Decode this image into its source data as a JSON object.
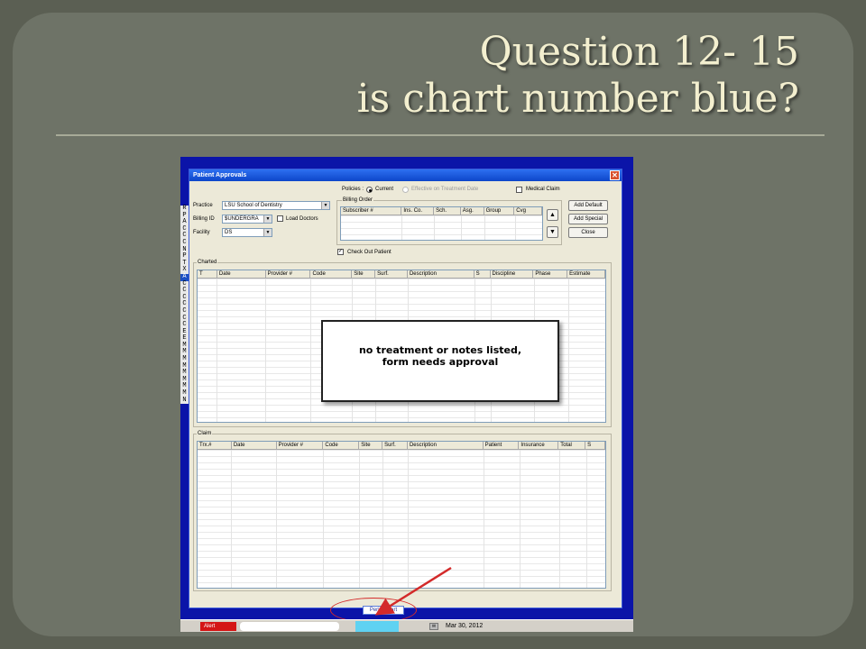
{
  "slide": {
    "title_line1": "Question 12- 15",
    "title_line2": "is chart number blue?"
  },
  "app": {
    "side_letters": [
      "R",
      "P",
      "A",
      "C",
      "C",
      "C",
      "N",
      "P",
      "T",
      "X",
      "A",
      "C",
      "C",
      "C",
      "C",
      "C",
      "C",
      "C",
      "E",
      "E",
      "M",
      "M",
      "M",
      "M",
      "M",
      "M",
      "M",
      "M",
      "N"
    ],
    "dialog": {
      "title": "Patient Approvals",
      "close_glyph": "✕",
      "practice_label": "Practice",
      "practice_value": "LSU School of Dentistry",
      "billing_id_label": "Billing ID",
      "billing_id_value": "$UNDERGRA",
      "load_doctors_label": "Load Doctors",
      "facility_label": "Facility",
      "facility_value": "DS",
      "policies_label": "Policies :",
      "current_label": "Current",
      "effective_label": "Effective on Treatment Date",
      "medical_claim_label": "Medical Claim",
      "billing_order_title": "Billing Order",
      "billing_columns": [
        "Subscriber #",
        "Ins. Co.",
        "Sch.",
        "Asg.",
        "Group",
        "Cvg"
      ],
      "check_out_label": "Check Out Patient",
      "check_mark": "✓",
      "buttons": {
        "add_default": "Add Default",
        "add_special": "Add Special",
        "close": "Close"
      },
      "charted_title": "Charted",
      "charted_columns": [
        "T",
        "Date",
        "Provider #",
        "Code",
        "Site",
        "Surf.",
        "Description",
        "S",
        "Discipline",
        "Phase",
        "Estimate"
      ],
      "claim_title": "Claim",
      "claim_columns": [
        "Trx.#",
        "Date",
        "Provider #",
        "Code",
        "Site",
        "Surf.",
        "Description",
        "Patient",
        "Insurance",
        "Total",
        "S"
      ],
      "perio_chart_label": "Perio Chart"
    },
    "callout_line1": "no treatment or notes listed,",
    "callout_line2": "form needs approval",
    "taskbar": {
      "alert_label": "Alert",
      "date": "Mar 30, 2012"
    }
  },
  "colors": {
    "slide_bg": "#6e7367",
    "title": "#f3efcf",
    "app_bg": "#0b14a8",
    "arrow": "#d32a2a",
    "cyan_field": "#5fd2f2"
  }
}
